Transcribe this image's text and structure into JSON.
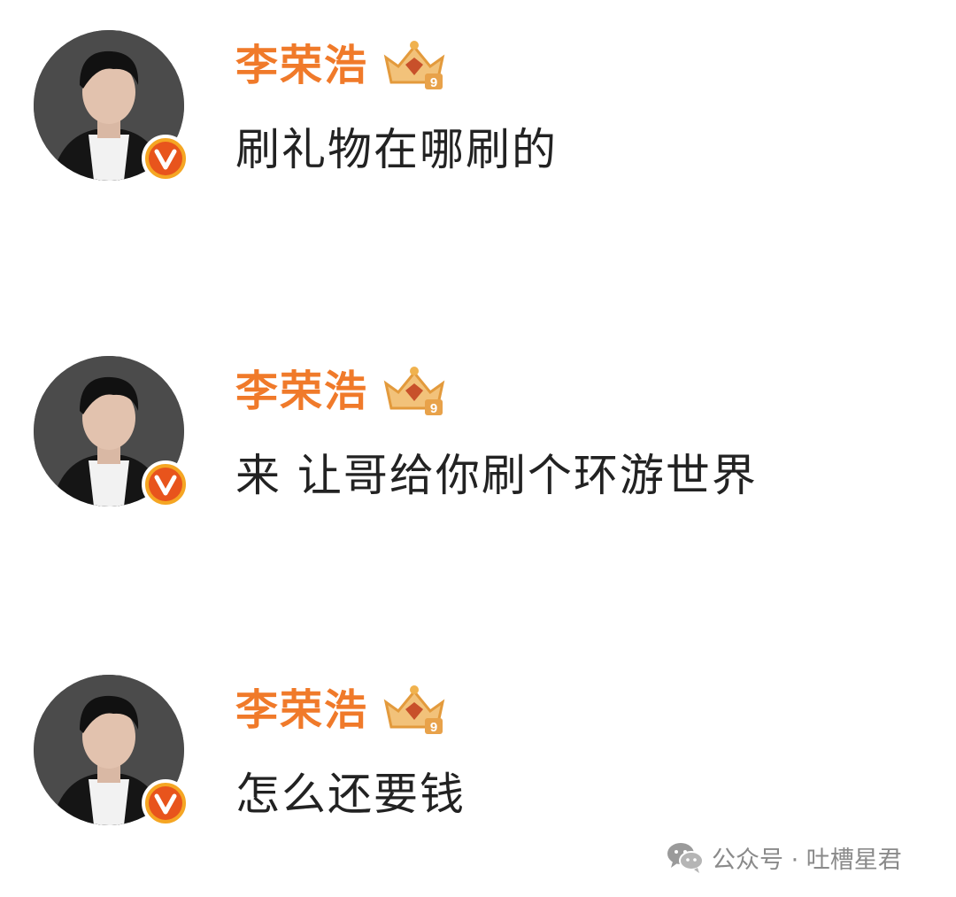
{
  "comments": [
    {
      "username": "李荣浩",
      "text": "刷礼物在哪刷的"
    },
    {
      "username": "李荣浩",
      "text": "来 让哥给你刷个环游世界"
    },
    {
      "username": "李荣浩",
      "text": "怎么还要钱"
    }
  ],
  "badges": {
    "verified_icon": "verified-v-icon",
    "crown_icon": "crown-level-icon",
    "crown_level": "9",
    "verified_color": "#f5a623",
    "username_color": "#f07a2a"
  },
  "watermark": {
    "icon": "wechat-icon",
    "label": "公众号 · 吐槽星君"
  }
}
